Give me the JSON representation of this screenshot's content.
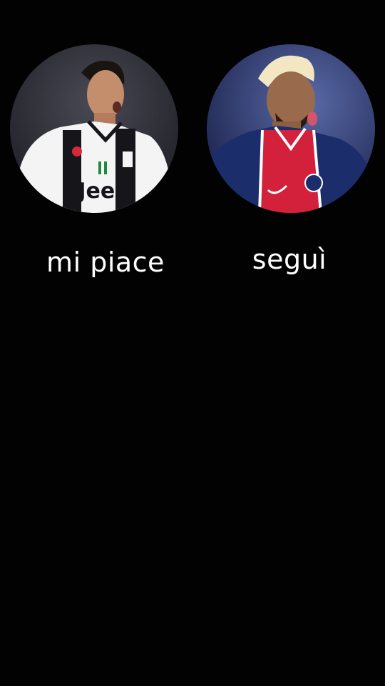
{
  "options": [
    {
      "caption": "mi piace",
      "jersey_text": "Jeep",
      "colors": {
        "kit_primary": "#f4f4f4",
        "kit_secondary": "#15151a",
        "background": "#2e2e38"
      }
    },
    {
      "caption": "seguì",
      "colors": {
        "kit_primary": "#1c2d6b",
        "kit_secondary": "#d3203b",
        "background": "#3a4a86"
      }
    }
  ]
}
